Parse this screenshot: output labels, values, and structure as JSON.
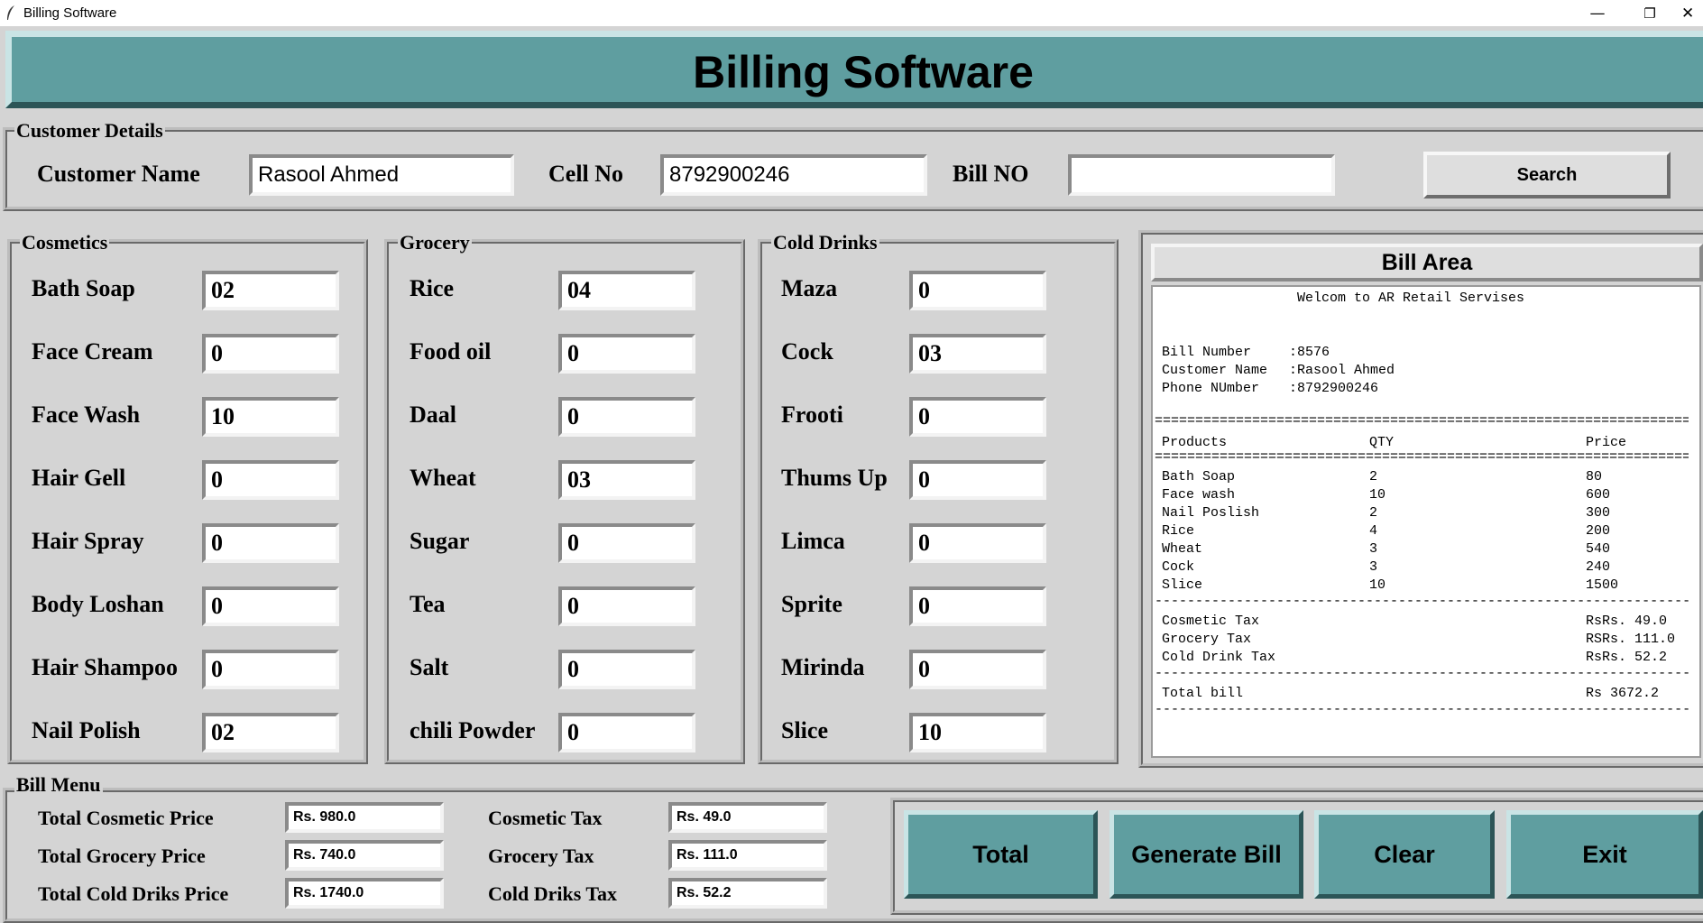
{
  "window": {
    "title": "Billing Software",
    "controls": {
      "minimize": "—",
      "maximize": "❐",
      "close": "✕"
    }
  },
  "header": {
    "title": "Billing Software"
  },
  "customer": {
    "frame_label": "Customer Details",
    "name_label": "Customer Name",
    "name_value": "Rasool Ahmed",
    "cell_label": "Cell No",
    "cell_value": "8792900246",
    "bill_label": "Bill NO",
    "bill_value": "",
    "search_label": "Search"
  },
  "cosmetics": {
    "frame_label": "Cosmetics",
    "items": [
      {
        "label": "Bath Soap",
        "value": "02"
      },
      {
        "label": "Face Cream",
        "value": "0"
      },
      {
        "label": "Face Wash",
        "value": "10"
      },
      {
        "label": "Hair Gell",
        "value": "0"
      },
      {
        "label": "Hair Spray",
        "value": "0"
      },
      {
        "label": "Body Loshan",
        "value": "0"
      },
      {
        "label": "Hair Shampoo",
        "value": "0"
      },
      {
        "label": "Nail Polish",
        "value": "02"
      }
    ]
  },
  "grocery": {
    "frame_label": "Grocery",
    "items": [
      {
        "label": "Rice",
        "value": "04"
      },
      {
        "label": "Food oil",
        "value": "0"
      },
      {
        "label": "Daal",
        "value": "0"
      },
      {
        "label": "Wheat",
        "value": "03"
      },
      {
        "label": "Sugar",
        "value": "0"
      },
      {
        "label": "Tea",
        "value": "0"
      },
      {
        "label": "Salt",
        "value": "0"
      },
      {
        "label": "chili Powder",
        "value": "0"
      }
    ]
  },
  "colddrinks": {
    "frame_label": "Cold Drinks",
    "items": [
      {
        "label": "Maza",
        "value": "0"
      },
      {
        "label": "Cock",
        "value": "03"
      },
      {
        "label": "Frooti",
        "value": "0"
      },
      {
        "label": "Thums Up",
        "value": "0"
      },
      {
        "label": "Limca",
        "value": "0"
      },
      {
        "label": "Sprite",
        "value": "0"
      },
      {
        "label": "Mirinda",
        "value": "0"
      },
      {
        "label": "Slice",
        "value": "10"
      }
    ]
  },
  "bill_area": {
    "title": "Bill Area",
    "welcome": "Welcom to AR Retail Servises",
    "bill_number_label": "Bill Number",
    "bill_number": ":8576",
    "customer_name_label": "Customer Name",
    "customer_name": ":Rasool Ahmed",
    "phone_label": "Phone NUmber",
    "phone": ":8792900246",
    "rule_double": "========================================================================",
    "rule_single": "------------------------------------------------------------------------",
    "headers": {
      "product": "Products",
      "qty": "QTY",
      "price": "Price"
    },
    "lines": [
      {
        "product": "Bath Soap",
        "qty": "2",
        "price": "80"
      },
      {
        "product": "Face wash",
        "qty": "10",
        "price": "600"
      },
      {
        "product": "Nail Poslish",
        "qty": "2",
        "price": "300"
      },
      {
        "product": "Rice",
        "qty": "4",
        "price": "200"
      },
      {
        "product": "Wheat",
        "qty": "3",
        "price": "540"
      },
      {
        "product": "Cock",
        "qty": "3",
        "price": "240"
      },
      {
        "product": "Slice",
        "qty": "10",
        "price": "1500"
      }
    ],
    "taxes": [
      {
        "label": "Cosmetic Tax",
        "value": "RsRs. 49.0"
      },
      {
        "label": "Grocery Tax",
        "value": "RSRs. 111.0"
      },
      {
        "label": "Cold Drink Tax",
        "value": "RsRs. 52.2"
      }
    ],
    "total_label": "Total bill",
    "total_value": "Rs 3672.2"
  },
  "bill_menu": {
    "frame_label": "Bill Menu",
    "total_cosmetic_label": "Total Cosmetic Price",
    "total_cosmetic_value": "Rs. 980.0",
    "total_grocery_label": "Total Grocery Price",
    "total_grocery_value": "Rs. 740.0",
    "total_cold_label": "Total Cold Driks Price",
    "total_cold_value": "Rs. 1740.0",
    "cosmetic_tax_label": "Cosmetic Tax",
    "cosmetic_tax_value": "Rs. 49.0",
    "grocery_tax_label": "Grocery Tax",
    "grocery_tax_value": "Rs. 111.0",
    "cold_tax_label": "Cold Driks Tax",
    "cold_tax_value": "Rs. 52.2",
    "buttons": {
      "total": "Total",
      "generate": "Generate Bill",
      "clear": "Clear",
      "exit": "Exit"
    }
  },
  "colors": {
    "accent": "#5f9ea0",
    "background": "#d4d4d4"
  }
}
